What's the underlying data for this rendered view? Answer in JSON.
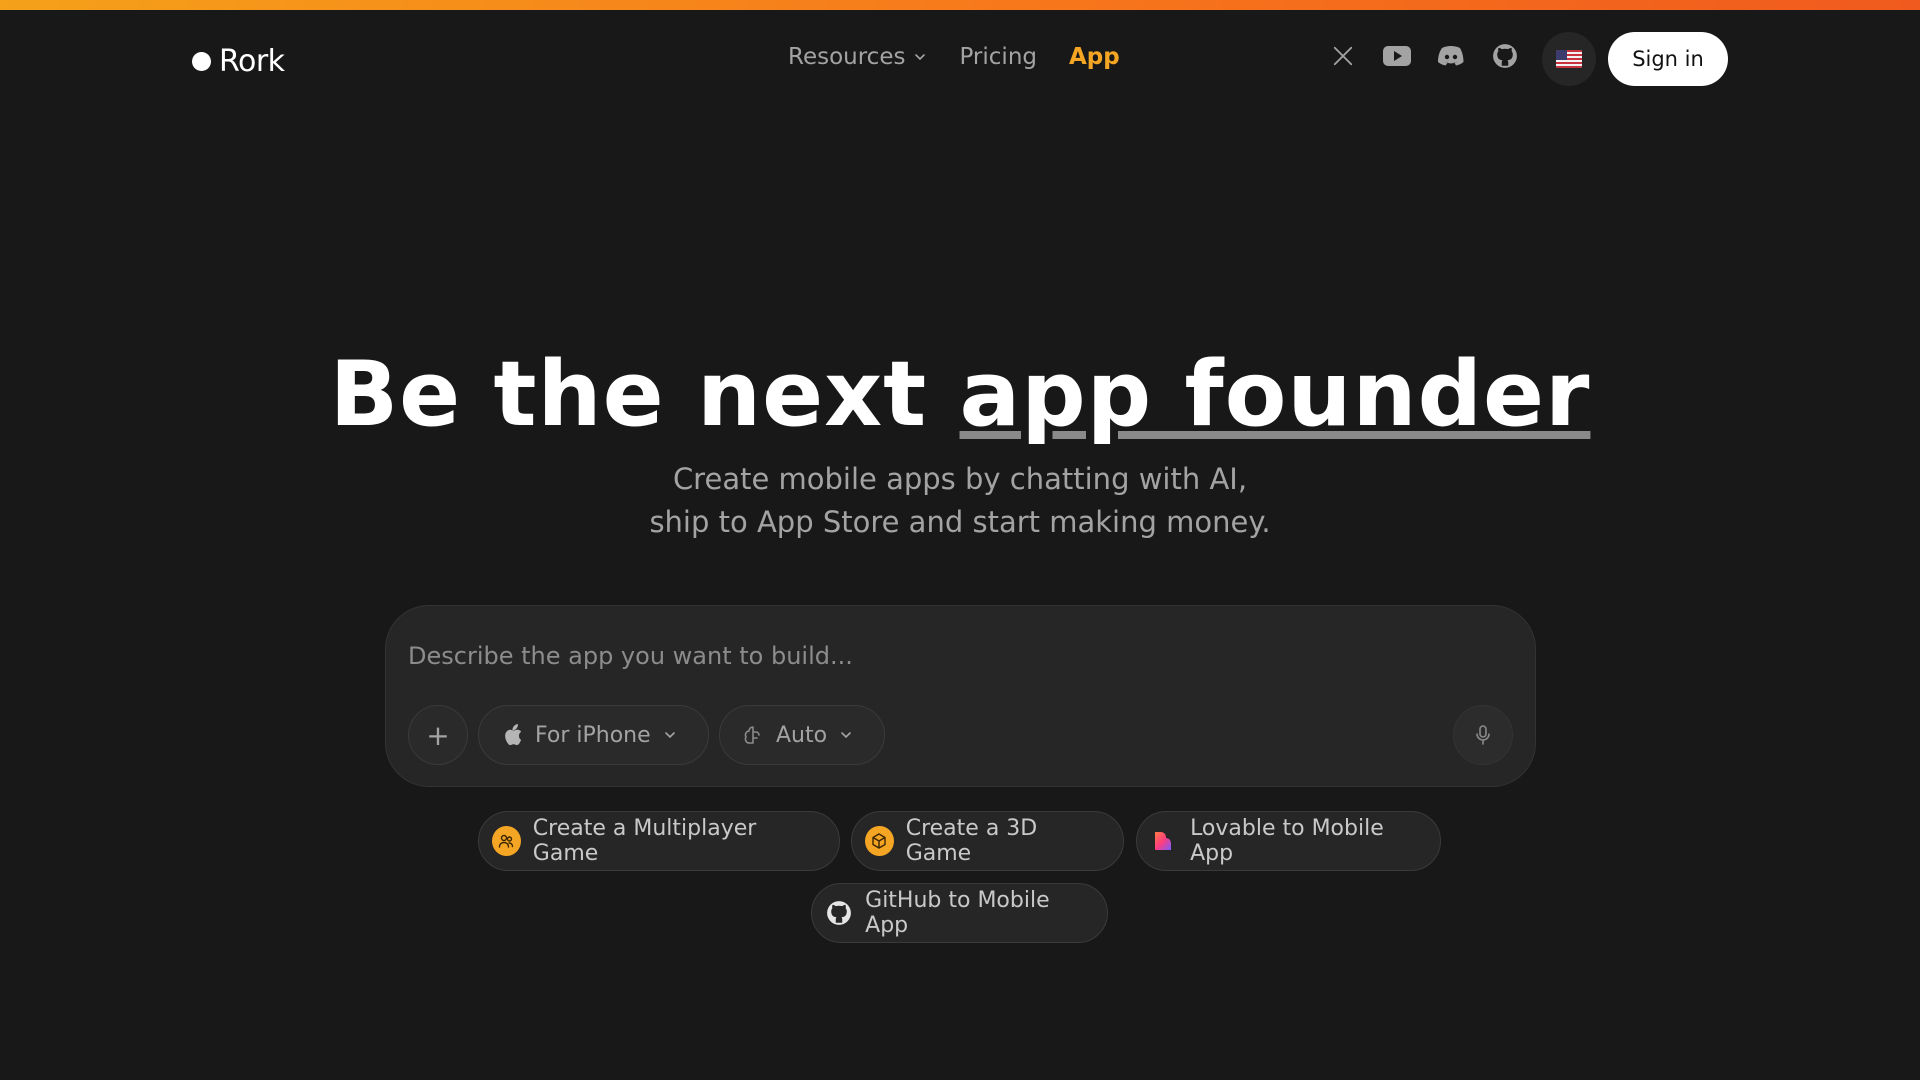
{
  "brand": {
    "name": "Rork"
  },
  "nav": {
    "items": [
      {
        "label": "Resources",
        "has_dropdown": true,
        "active": false
      },
      {
        "label": "Pricing",
        "has_dropdown": false,
        "active": false
      },
      {
        "label": "App",
        "has_dropdown": false,
        "active": true
      }
    ]
  },
  "social_icons": [
    "x-icon",
    "youtube-icon",
    "discord-icon",
    "github-icon"
  ],
  "language": {
    "icon": "us-flag-icon"
  },
  "auth": {
    "sign_in_label": "Sign in"
  },
  "hero": {
    "title_plain": "Be the next ",
    "title_underlined": "app founder",
    "subtitle_line1": "Create mobile apps by chatting with AI,",
    "subtitle_line2": "ship to App Store and start making money."
  },
  "composer": {
    "placeholder": "Describe the app you want to build...",
    "value": "",
    "add_label": "+",
    "platform_label": "For iPhone",
    "model_label": "Auto"
  },
  "suggestions": [
    {
      "label": "Create a Multiplayer Game",
      "icon": "users-icon"
    },
    {
      "label": "Create a 3D Game",
      "icon": "cube-icon"
    },
    {
      "label": "Lovable to Mobile App",
      "icon": "lovable-heart-icon"
    },
    {
      "label": "GitHub to Mobile App",
      "icon": "github-icon"
    }
  ],
  "colors": {
    "background": "#181818",
    "accent": "#f5a524",
    "muted_text": "#a3a3a3",
    "panel": "#262626"
  }
}
